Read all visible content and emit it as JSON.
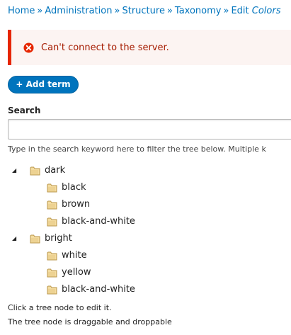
{
  "breadcrumb": {
    "items": [
      "Home",
      "Administration",
      "Structure",
      "Taxonomy"
    ],
    "separator": "»",
    "current_prefix": "Edit",
    "current_name": "Colors"
  },
  "alert": {
    "message": "Can't connect to the server.",
    "icon": "error-icon",
    "color": "#e62600"
  },
  "toolbar": {
    "add_term_label": "+ Add term"
  },
  "search": {
    "label": "Search",
    "value": "",
    "placeholder": "",
    "help": "Type in the search keyword here to filter the tree below. Multiple k"
  },
  "tree": {
    "nodes": [
      {
        "label": "dark",
        "expanded": true,
        "children": [
          "black",
          "brown",
          "black-and-white"
        ]
      },
      {
        "label": "bright",
        "expanded": true,
        "children": [
          "white",
          "yellow",
          "black-and-white"
        ]
      }
    ]
  },
  "footer": {
    "hint": "Click a tree node to edit it.",
    "dnd": "The tree node is draggable and droppable"
  },
  "colors": {
    "link": "#0074bd",
    "button": "#0074bd",
    "error": "#e62600"
  }
}
